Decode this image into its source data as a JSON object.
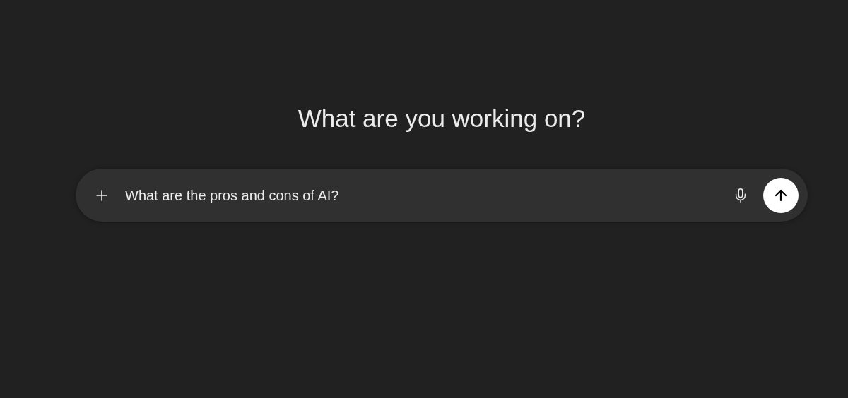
{
  "heading": "What are you working on?",
  "composer": {
    "value": "What are the pros and cons of AI?"
  }
}
